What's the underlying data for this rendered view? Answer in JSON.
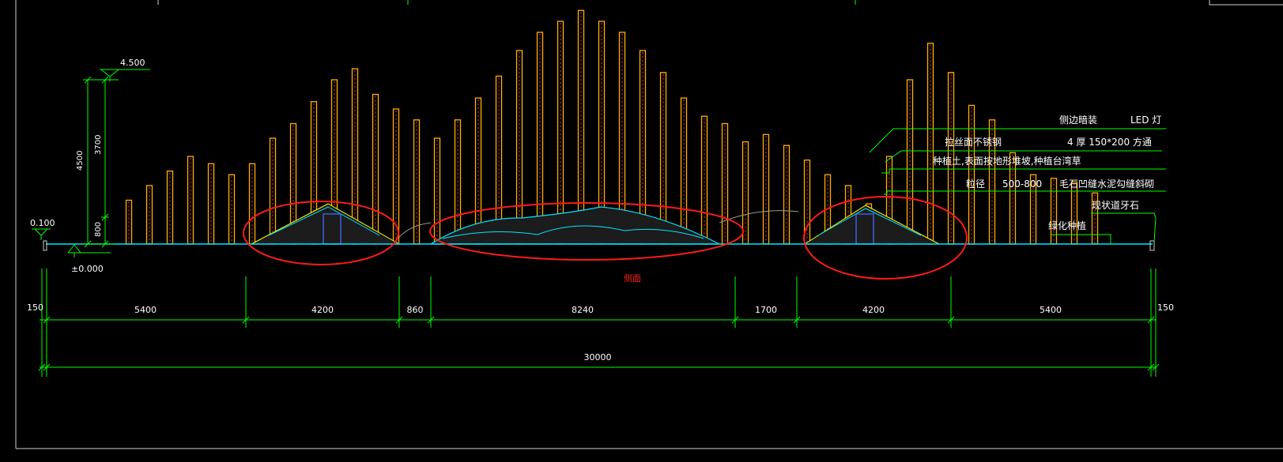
{
  "drawing": {
    "title": "侧面",
    "colors": {
      "background": "#000000",
      "dimension": "#00ff00",
      "dimension_text": "#ffffff",
      "ground": "#00e5ff",
      "column_frame": "#ffb000",
      "column_light": "#ff3030",
      "mound_outline": "#ffff00",
      "highlight_circle": "#ff1a1a",
      "leader": "#00ff00",
      "annotation_text": "#ffffff",
      "title_text": "#ff2020"
    },
    "elevations": {
      "top": "4.500",
      "ground": "±0.000",
      "left_step": "0.100"
    },
    "vertical_dims": {
      "total": "4500",
      "upper": "3700",
      "lower": "800"
    },
    "horizontal_dims": {
      "end_left": "150",
      "end_right": "150",
      "segments": [
        "5400",
        "4200",
        "860",
        "8240",
        "1700",
        "4200",
        "5400"
      ],
      "total": "30000"
    },
    "annotations": [
      {
        "left": "侧边暗装",
        "right": "LED 灯"
      },
      {
        "left": "拉丝面不锈钢",
        "right": "4 厚  150*200  方通"
      },
      {
        "left": "种植土,表面按地形堆坡,种植台湾草",
        "right": ""
      },
      {
        "left": "粒径",
        "mid": "500-800",
        "right": "毛石凹缝水泥勾缝斜砌"
      },
      {
        "left": "现状道牙石",
        "right": ""
      },
      {
        "left": "绿化种植",
        "right": ""
      }
    ],
    "column_heights_mm": [
      1200,
      1600,
      2000,
      2400,
      2200,
      1900,
      2200,
      2900,
      3300,
      3900,
      4500,
      4800,
      4100,
      3700,
      3400,
      2900,
      3400,
      4000,
      4600,
      5300,
      5800,
      6100,
      6400,
      6100,
      5800,
      5300,
      4700,
      4000,
      3500,
      3300,
      2800,
      3000,
      2700,
      2300,
      1900,
      1600,
      1100,
      2400,
      4500,
      5500,
      4700,
      3800,
      3400,
      2500,
      1900,
      1800,
      1700,
      1400
    ]
  }
}
